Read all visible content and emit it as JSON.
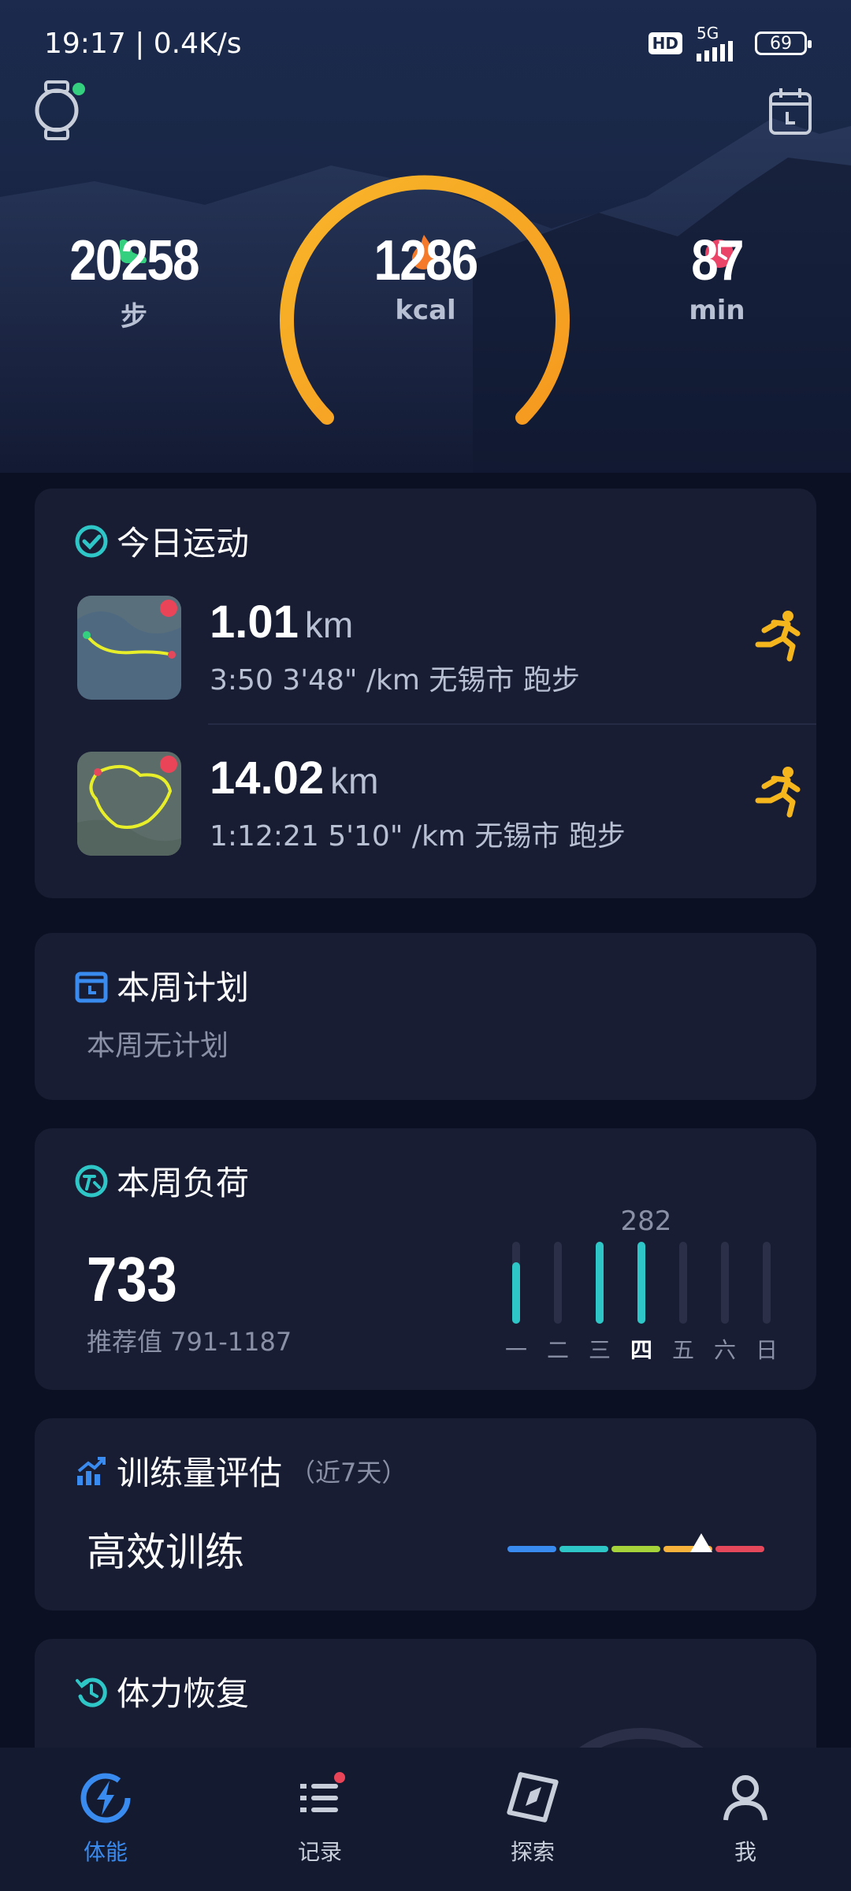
{
  "status_bar": {
    "time_speed": "19:17 | 0.4K/s",
    "hd": "HD",
    "network": "5G",
    "battery": "69"
  },
  "stats": {
    "steps": {
      "value": "20258",
      "unit": "步"
    },
    "calories": {
      "value": "1286",
      "unit": "kcal"
    },
    "minutes": {
      "value": "87",
      "unit": "min"
    }
  },
  "today": {
    "title": "今日运动",
    "activities": [
      {
        "distance": "1.01",
        "unit": "km",
        "meta": "3:50  3'48\" /km  无锡市 跑步"
      },
      {
        "distance": "14.02",
        "unit": "km",
        "meta": "1:12:21  5'10\" /km  无锡市 跑步"
      }
    ]
  },
  "plan": {
    "title": "本周计划",
    "empty": "本周无计划"
  },
  "load": {
    "title": "本周负荷",
    "value": "733",
    "recommended": "推荐值 791-1187",
    "peak_label": "282",
    "days": [
      "一",
      "二",
      "三",
      "四",
      "五",
      "六",
      "日"
    ],
    "levels": [
      0.75,
      0,
      1,
      1,
      0,
      0,
      0
    ]
  },
  "training": {
    "title": "训练量评估",
    "period": "（近7天）",
    "status": "高效训练",
    "colors": [
      "#3a8bf0",
      "#2ec6c6",
      "#a6d23a",
      "#f6b23a",
      "#e5485a"
    ]
  },
  "recovery": {
    "title": "体力恢复"
  },
  "tabs": [
    {
      "label": "体能",
      "icon": "energy-icon",
      "active": true
    },
    {
      "label": "记录",
      "icon": "list-icon",
      "badge": true
    },
    {
      "label": "探索",
      "icon": "compass-icon"
    },
    {
      "label": "我",
      "icon": "person-icon"
    }
  ],
  "colors": {
    "accent": "#3a8bf0",
    "ring": "#f6a91e",
    "teal": "#2ec6c6",
    "runner": "#f5b51c"
  }
}
